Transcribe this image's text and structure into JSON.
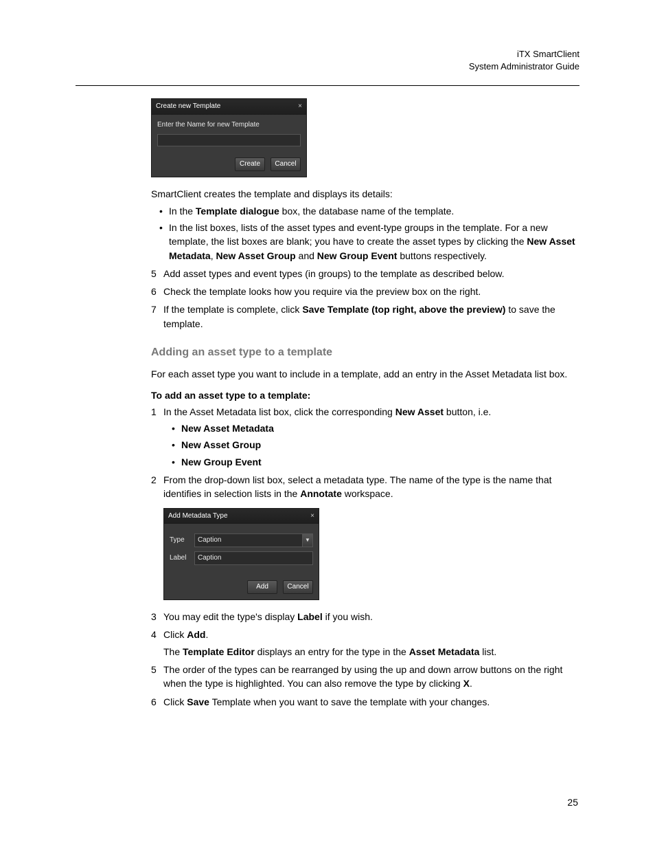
{
  "header": {
    "product": "iTX SmartClient",
    "doc": "System Administrator Guide"
  },
  "page_number": "25",
  "dialog1": {
    "title": "Create new Template",
    "close": "×",
    "prompt": "Enter the Name for new Template",
    "create": "Create",
    "cancel": "Cancel"
  },
  "intro_line": "SmartClient creates the template and displays its details:",
  "bullet_a_pre": "In the ",
  "bullet_a_bold": "Template dialogue",
  "bullet_a_post": " box, the database name of the template.",
  "bullet_b_pre": "In the list boxes, lists of the asset types and event-type groups in the template. For a new template, the list boxes are blank; you have to create the asset types by clicking the ",
  "bullet_b_b1": "New Asset Metadata",
  "bullet_b_mid1": ", ",
  "bullet_b_b2": "New Asset Group",
  "bullet_b_mid2": " and ",
  "bullet_b_b3": "New Group Event",
  "bullet_b_post": " buttons respectively.",
  "step5": "Add asset types and event types (in groups) to the template as described below.",
  "step6": "Check the template looks how you require via the preview box on the right.",
  "step7_pre": "If the template is complete, click ",
  "step7_bold": "Save Template (top right, above the preview)",
  "step7_post": " to save the template.",
  "section_heading": "Adding an asset type to a template",
  "section_intro": "For each asset type you want to include in a template, add an entry in the Asset Metadata list box.",
  "procedure_title": "To add an asset type to a template:",
  "p1_pre": "In the Asset Metadata list box, click the corresponding ",
  "p1_bold": "New Asset",
  "p1_post": " button, i.e.",
  "p1_b1": "New Asset Metadata",
  "p1_b2": "New Asset Group",
  "p1_b3": "New Group Event",
  "p2_pre": "From the drop-down list box, select a metadata type. The name of the type is the name that identifies in selection lists in the ",
  "p2_bold": "Annotate",
  "p2_post": " workspace.",
  "dialog2": {
    "title": "Add Metadata Type",
    "close": "×",
    "type_label": "Type",
    "type_value": "Caption",
    "label_label": "Label",
    "label_value": "Caption",
    "add": "Add",
    "cancel": "Cancel"
  },
  "p3_pre": "You may edit the type's display ",
  "p3_bold": "Label",
  "p3_post": " if you wish.",
  "p4_pre": "Click ",
  "p4_bold": "Add",
  "p4_post": ".",
  "p4_cont_pre": "The ",
  "p4_cont_b1": "Template Editor",
  "p4_cont_mid": " displays an entry for the type in the ",
  "p4_cont_b2": "Asset Metadata",
  "p4_cont_post": " list.",
  "p5_pre": "The order of the types can be rearranged by using the up and down arrow buttons on the right when the type is highlighted. You can also remove the type by clicking ",
  "p5_bold": "X",
  "p5_post": ".",
  "p6_pre": "Click ",
  "p6_bold": "Save",
  "p6_post": " Template when you want to save the template with your changes."
}
